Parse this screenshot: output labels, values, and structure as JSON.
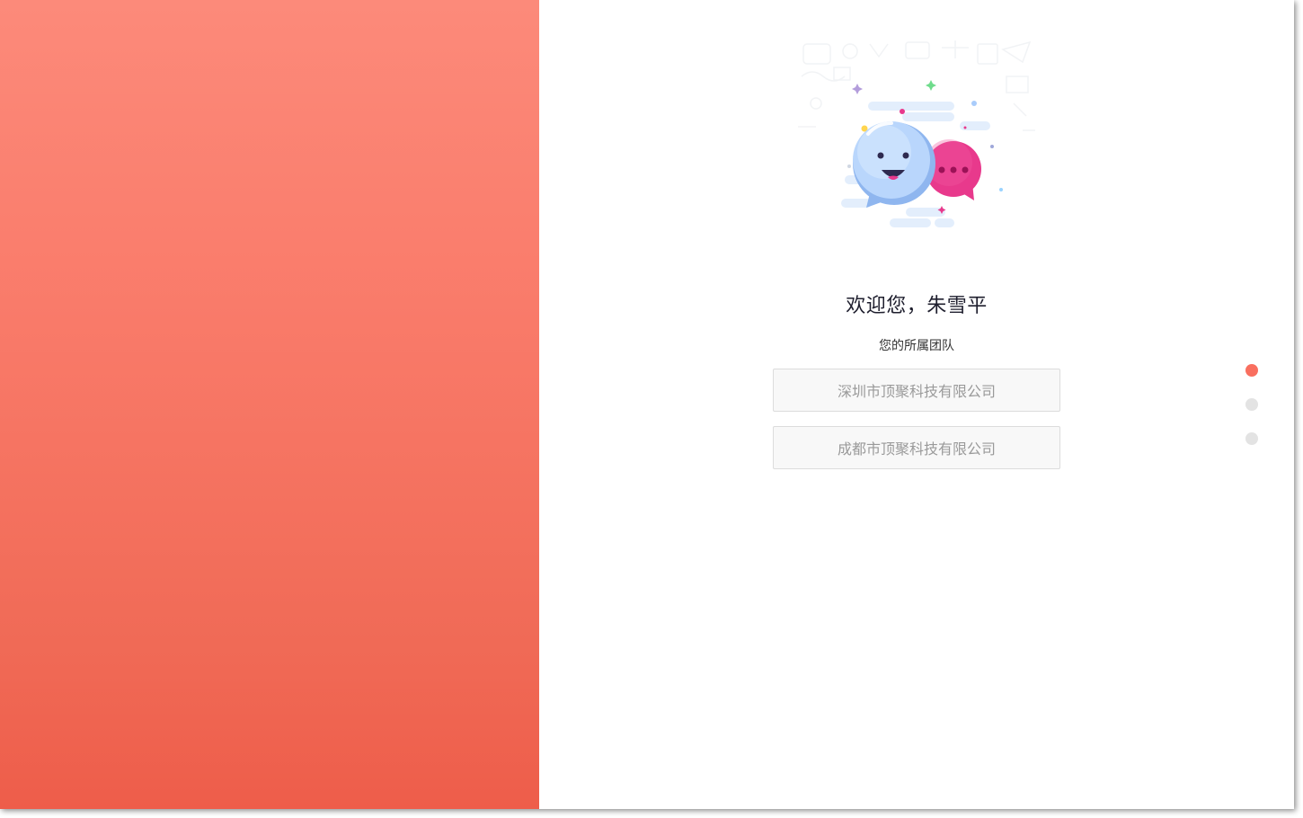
{
  "welcome": {
    "greeting": "欢迎您，朱雪平",
    "team_label": "您的所属团队"
  },
  "teams": [
    {
      "name": "深圳市顶聚科技有限公司"
    },
    {
      "name": "成都市顶聚科技有限公司"
    }
  ],
  "pager": {
    "count": 3,
    "active_index": 0
  },
  "colors": {
    "accent": "#f96f5f",
    "gradient_top": "#fc8a7a",
    "gradient_bottom": "#ee5d4a",
    "bubble_blue": "#a9ccfb",
    "bubble_pink": "#e8398c"
  },
  "icons": {
    "illustration": "chat-bubbles-illustration"
  }
}
